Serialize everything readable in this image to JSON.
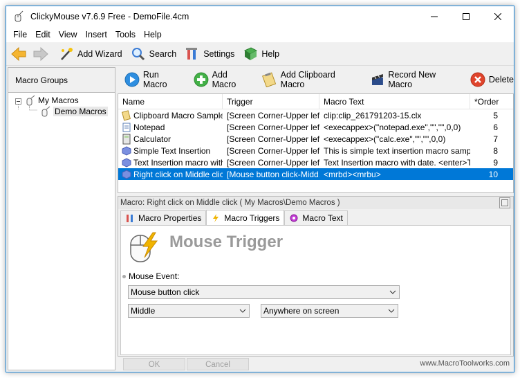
{
  "window": {
    "title": "ClickyMouse v7.6.9 Free - DemoFile.4cm"
  },
  "menu": [
    "File",
    "Edit",
    "View",
    "Insert",
    "Tools",
    "Help"
  ],
  "toolbar": {
    "add_wizard": "Add Wizard",
    "search": "Search",
    "settings": "Settings",
    "help": "Help"
  },
  "macro_groups": {
    "header": "Macro Groups",
    "tree": {
      "root": "My Macros",
      "child": "Demo Macros"
    }
  },
  "macro_toolbar": {
    "run": "Run Macro",
    "add": "Add Macro",
    "add_clipboard": "Add Clipboard Macro",
    "record": "Record New Macro",
    "delete": "Delete"
  },
  "list": {
    "columns": [
      "Name",
      "Trigger",
      "Macro Text",
      "*Order"
    ],
    "rows": [
      {
        "name": "Clipboard Macro Sample",
        "trigger": "[Screen Corner-Upper left]",
        "text": "clip:clip_261791203-15.clx",
        "order": "5",
        "icon": "clipboard-icon"
      },
      {
        "name": "Notepad",
        "trigger": "[Screen Corner-Upper left]",
        "text": "<execappex>(\"notepad.exe\",\"\",\"\",0,0)",
        "order": "6",
        "icon": "notepad-icon"
      },
      {
        "name": "Calculator",
        "trigger": "[Screen Corner-Upper left]",
        "text": "<execappex>(\"calc.exe\",\"\",\"\",0,0)",
        "order": "7",
        "icon": "calculator-icon"
      },
      {
        "name": "Simple Text Insertion",
        "trigger": "[Screen Corner-Upper left]",
        "text": "This is simple text insertion macro sample.",
        "order": "8",
        "icon": "macro-icon"
      },
      {
        "name": "Text Insertion macro with...",
        "trigger": "[Screen Corner-Upper left]",
        "text": "Text Insertion macro with date. <enter>To...",
        "order": "9",
        "icon": "macro-icon"
      },
      {
        "name": "Right click on Middle click",
        "trigger": "[Mouse button click-Midd...",
        "text": "<mrbd><mrbu>",
        "order": "10",
        "icon": "macro-icon"
      }
    ],
    "selected_index": 5
  },
  "detail": {
    "title": "Macro: Right click on Middle click ( My Macros\\Demo Macros )",
    "tabs": [
      "Macro Properties",
      "Macro Triggers",
      "Macro Text"
    ],
    "active_tab": "Macro Triggers",
    "banner": "Mouse Trigger",
    "event_label": "Mouse Event:",
    "event_type": "Mouse button click",
    "button": "Middle",
    "location": "Anywhere on screen"
  },
  "footer": {
    "ok": "OK",
    "cancel": "Cancel",
    "website": "www.MacroToolworks.com"
  }
}
